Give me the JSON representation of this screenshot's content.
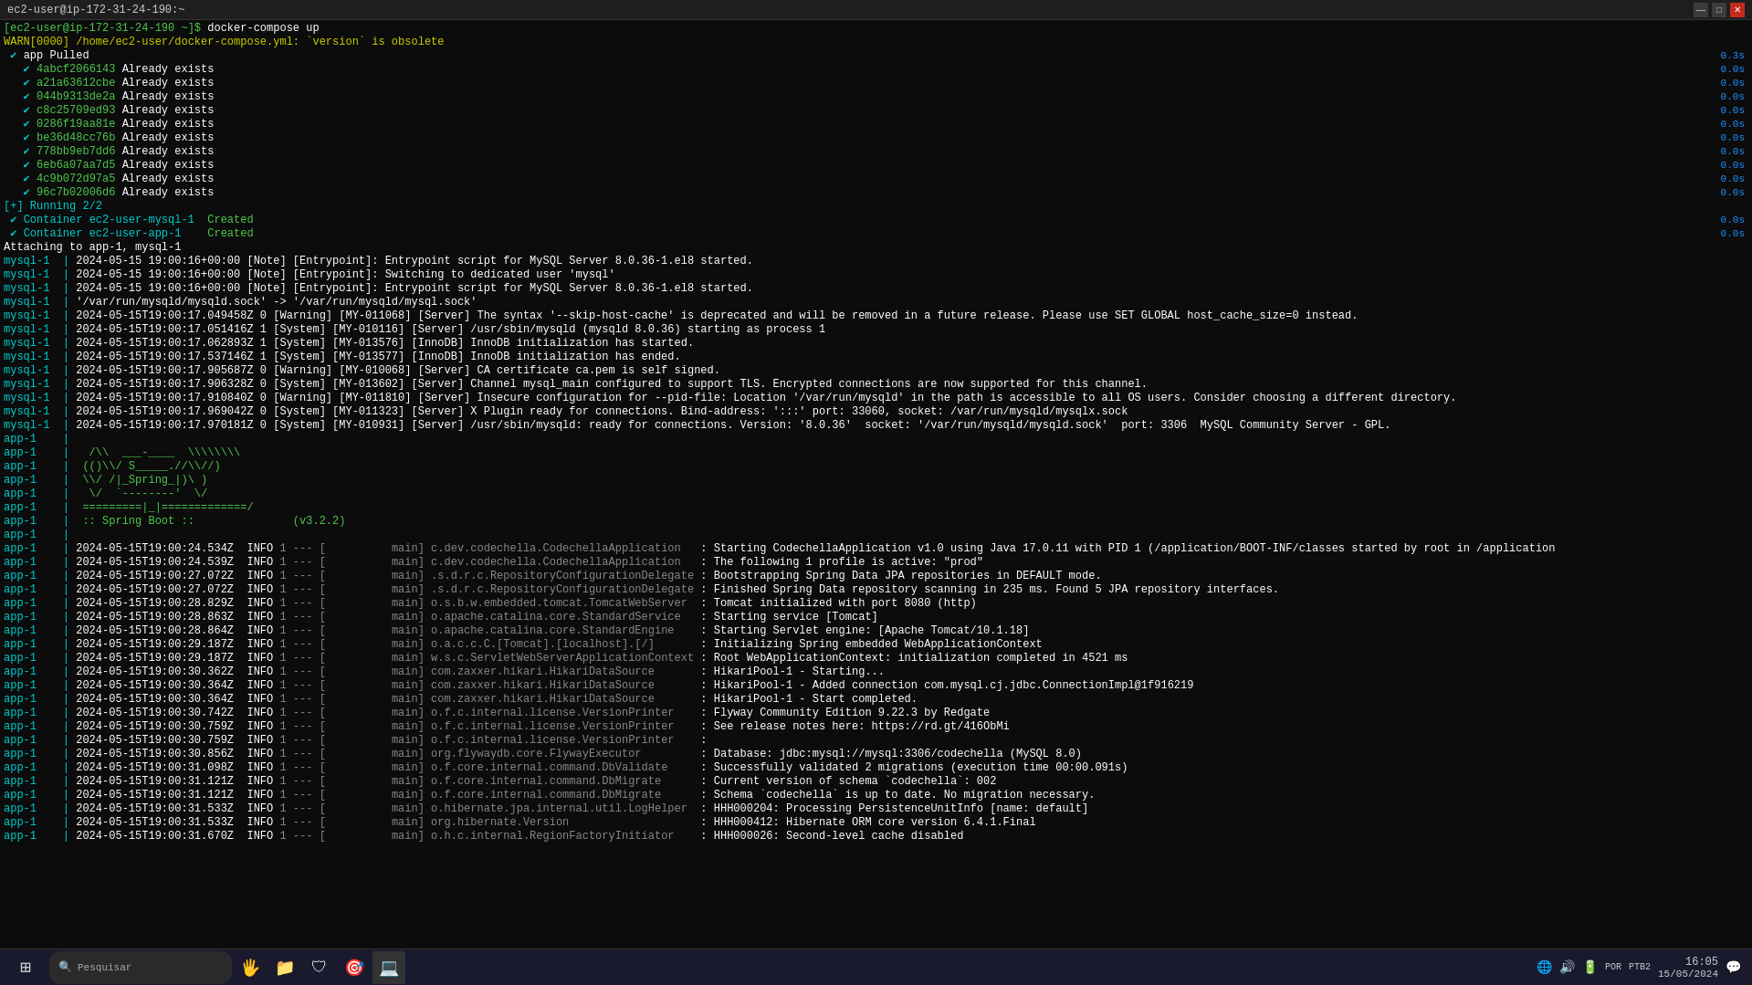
{
  "titlebar": {
    "title": "ec2-user@ip-172-31-24-190:~",
    "minimize": "—",
    "maximize": "□",
    "close": "✕"
  },
  "terminal": {
    "lines": [
      {
        "text": "[ec2-user@ip-172-31-24-190 ~]$ docker-compose up",
        "type": "prompt",
        "right": ""
      },
      {
        "text": "WARN[0000] /home/ec2-user/docker-compose.yml: `version` is obsolete",
        "type": "warn",
        "right": ""
      },
      {
        "text": " ✔ app Pulled",
        "type": "pulled",
        "right": "0.3s"
      },
      {
        "text": "   ✔ 4abcf2066143 Already exists",
        "type": "exists",
        "right": "0.0s"
      },
      {
        "text": "   ✔ a21a63612cbe Already exists",
        "type": "exists",
        "right": "0.0s"
      },
      {
        "text": "   ✔ 044b9313de2a Already exists",
        "type": "exists",
        "right": "0.0s"
      },
      {
        "text": "   ✔ c8c25709ed93 Already exists",
        "type": "exists",
        "right": "0.0s"
      },
      {
        "text": "   ✔ 0286f19aa81e Already exists",
        "type": "exists",
        "right": "0.0s"
      },
      {
        "text": "   ✔ be36d48cc76b Already exists",
        "type": "exists",
        "right": "0.0s"
      },
      {
        "text": "   ✔ 778bb9eb7dd6 Already exists",
        "type": "exists",
        "right": "0.0s"
      },
      {
        "text": "   ✔ 6eb6a07aa7d5 Already exists",
        "type": "exists",
        "right": "0.0s"
      },
      {
        "text": "   ✔ 4c9b072d97a5 Already exists",
        "type": "exists",
        "right": "0.0s"
      },
      {
        "text": "   ✔ 96c7b02006d6 Already exists",
        "type": "exists",
        "right": "0.0s"
      },
      {
        "text": "[+] Running 2/2",
        "type": "running",
        "right": ""
      },
      {
        "text": " ✔ Container ec2-user-mysql-1  Created",
        "type": "created",
        "right": "0.0s"
      },
      {
        "text": " ✔ Container ec2-user-app-1    Created",
        "type": "created",
        "right": "0.0s"
      },
      {
        "text": "Attaching to app-1, mysql-1",
        "type": "normal",
        "right": ""
      },
      {
        "text": "mysql-1  | 2024-05-15 19:00:16+00:00 [Note] [Entrypoint]: Entrypoint script for MySQL Server 8.0.36-1.el8 started.",
        "type": "mysql",
        "right": ""
      },
      {
        "text": "mysql-1  | 2024-05-15 19:00:16+00:00 [Note] [Entrypoint]: Switching to dedicated user 'mysql'",
        "type": "mysql",
        "right": ""
      },
      {
        "text": "mysql-1  | 2024-05-15 19:00:16+00:00 [Note] [Entrypoint]: Entrypoint script for MySQL Server 8.0.36-1.el8 started.",
        "type": "mysql",
        "right": ""
      },
      {
        "text": "mysql-1  | '/var/run/mysqld/mysqld.sock' -> '/var/run/mysqld/mysql.sock'",
        "type": "mysql",
        "right": ""
      },
      {
        "text": "mysql-1  | 2024-05-15T19:00:17.049458Z 0 [Warning] [MY-011068] [Server] The syntax '--skip-host-cache' is deprecated and will be removed in a future release. Please use SET GLOBAL host_cache_size=0 instead.",
        "type": "mysql",
        "right": ""
      },
      {
        "text": "mysql-1  | 2024-05-15T19:00:17.051416Z 1 [System] [MY-010116] [Server] /usr/sbin/mysqld (mysqld 8.0.36) starting as process 1",
        "type": "mysql",
        "right": ""
      },
      {
        "text": "mysql-1  | 2024-05-15T19:00:17.062893Z 1 [System] [MY-013576] [InnoDB] InnoDB initialization has started.",
        "type": "mysql",
        "right": ""
      },
      {
        "text": "mysql-1  | 2024-05-15T19:00:17.537146Z 1 [System] [MY-013577] [InnoDB] InnoDB initialization has ended.",
        "type": "mysql",
        "right": ""
      },
      {
        "text": "mysql-1  | 2024-05-15T19:00:17.905687Z 0 [Warning] [MY-010068] [Server] CA certificate ca.pem is self signed.",
        "type": "mysql",
        "right": ""
      },
      {
        "text": "mysql-1  | 2024-05-15T19:00:17.906328Z 0 [System] [MY-013602] [Server] Channel mysql_main configured to support TLS. Encrypted connections are now supported for this channel.",
        "type": "mysql",
        "right": ""
      },
      {
        "text": "mysql-1  | 2024-05-15T19:00:17.910840Z 0 [Warning] [MY-011810] [Server] Insecure configuration for --pid-file: Location '/var/run/mysqld' in the path is accessible to all OS users. Consider choosing a different directory.",
        "type": "mysql",
        "right": ""
      },
      {
        "text": "mysql-1  | 2024-05-15T19:00:17.969042Z 0 [System] [MY-011323] [Server] X Plugin ready for connections. Bind-address: ':::' port: 33060, socket: /var/run/mysqld/mysqlx.sock",
        "type": "mysql",
        "right": ""
      },
      {
        "text": "mysql-1  | 2024-05-15T19:00:17.970181Z 0 [System] [MY-010931] [Server] /usr/sbin/mysqld: ready for connections. Version: '8.0.36'  socket: '/var/run/mysqld/mysqld.sock'  port: 3306  MySQL Community Server - GPL.",
        "type": "mysql",
        "right": ""
      },
      {
        "text": "app-1    |",
        "type": "app",
        "right": ""
      },
      {
        "text": "app-1    |   /\\\\  ___-____  \\\\\\\\\\\\\\\\",
        "type": "spring",
        "right": ""
      },
      {
        "text": "app-1    |  (()\\\\/ S_____.//\\\\//)",
        "type": "spring",
        "right": ""
      },
      {
        "text": "app-1    |  \\\\/ /|_Spring_|)\\ )",
        "type": "spring",
        "right": ""
      },
      {
        "text": "app-1    |   \\/  `--------'  \\/",
        "type": "spring",
        "right": ""
      },
      {
        "text": "app-1    |  =========|_|=============/",
        "type": "spring",
        "right": ""
      },
      {
        "text": "app-1    |  :: Spring Boot ::               (v3.2.2)",
        "type": "spring",
        "right": ""
      },
      {
        "text": "app-1    |",
        "type": "app",
        "right": ""
      },
      {
        "text": "app-1    | 2024-05-15T19:00:24.534Z  INFO 1 --- [          main] c.dev.codechella.CodechellaApplication   : Starting CodechellaApplication v1.0 using Java 17.0.11 with PID 1 (/application/BOOT-INF/classes started by root in /application",
        "type": "app",
        "right": ""
      },
      {
        "text": "app-1    | 2024-05-15T19:00:24.539Z  INFO 1 --- [          main] c.dev.codechella.CodechellaApplication   : The following 1 profile is active: \"prod\"",
        "type": "app",
        "right": ""
      },
      {
        "text": "app-1    | 2024-05-15T19:00:27.072Z  INFO 1 --- [          main] .s.d.r.c.RepositoryConfigurationDelegate : Bootstrapping Spring Data JPA repositories in DEFAULT mode.",
        "type": "app",
        "right": ""
      },
      {
        "text": "app-1    | 2024-05-15T19:00:27.072Z  INFO 1 --- [          main] .s.d.r.c.RepositoryConfigurationDelegate : Finished Spring Data repository scanning in 235 ms. Found 5 JPA repository interfaces.",
        "type": "app",
        "right": ""
      },
      {
        "text": "app-1    | 2024-05-15T19:00:28.829Z  INFO 1 --- [          main] o.s.b.w.embedded.tomcat.TomcatWebServer  : Tomcat initialized with port 8080 (http)",
        "type": "app",
        "right": ""
      },
      {
        "text": "app-1    | 2024-05-15T19:00:28.863Z  INFO 1 --- [          main] o.apache.catalina.core.StandardService   : Starting service [Tomcat]",
        "type": "app",
        "right": ""
      },
      {
        "text": "app-1    | 2024-05-15T19:00:28.864Z  INFO 1 --- [          main] o.apache.catalina.core.StandardEngine    : Starting Servlet engine: [Apache Tomcat/10.1.18]",
        "type": "app",
        "right": ""
      },
      {
        "text": "app-1    | 2024-05-15T19:00:29.187Z  INFO 1 --- [          main] o.a.c.c.C.[Tomcat].[localhost].[/]       : Initializing Spring embedded WebApplicationContext",
        "type": "app",
        "right": ""
      },
      {
        "text": "app-1    | 2024-05-15T19:00:29.187Z  INFO 1 --- [          main] w.s.c.ServletWebServerApplicationContext : Root WebApplicationContext: initialization completed in 4521 ms",
        "type": "app",
        "right": ""
      },
      {
        "text": "app-1    | 2024-05-15T19:00:30.362Z  INFO 1 --- [          main] com.zaxxer.hikari.HikariDataSource       : HikariPool-1 - Starting...",
        "type": "app",
        "right": ""
      },
      {
        "text": "app-1    | 2024-05-15T19:00:30.364Z  INFO 1 --- [          main] com.zaxxer.hikari.HikariDataSource       : HikariPool-1 - Added connection com.mysql.cj.jdbc.ConnectionImpl@1f916219",
        "type": "app",
        "right": ""
      },
      {
        "text": "app-1    | 2024-05-15T19:00:30.364Z  INFO 1 --- [          main] com.zaxxer.hikari.HikariDataSource       : HikariPool-1 - Start completed.",
        "type": "app",
        "right": ""
      },
      {
        "text": "app-1    | 2024-05-15T19:00:30.742Z  INFO 1 --- [          main] o.f.c.internal.license.VersionPrinter    : Flyway Community Edition 9.22.3 by Redgate",
        "type": "app",
        "right": ""
      },
      {
        "text": "app-1    | 2024-05-15T19:00:30.759Z  INFO 1 --- [          main] o.f.c.internal.license.VersionPrinter    : See release notes here: https://rd.gt/416ObMi",
        "type": "app",
        "right": ""
      },
      {
        "text": "app-1    | 2024-05-15T19:00:30.759Z  INFO 1 --- [          main] o.f.c.internal.license.VersionPrinter    :",
        "type": "app",
        "right": ""
      },
      {
        "text": "app-1    | 2024-05-15T19:00:30.856Z  INFO 1 --- [          main] org.flywaydb.core.FlywayExecutor         : Database: jdbc:mysql://mysql:3306/codechella (MySQL 8.0)",
        "type": "app",
        "right": ""
      },
      {
        "text": "app-1    | 2024-05-15T19:00:31.098Z  INFO 1 --- [          main] o.f.core.internal.command.DbValidate     : Successfully validated 2 migrations (execution time 00:00.091s)",
        "type": "app",
        "right": ""
      },
      {
        "text": "app-1    | 2024-05-15T19:00:31.121Z  INFO 1 --- [          main] o.f.core.internal.command.DbMigrate      : Current version of schema `codechella`: 002",
        "type": "app",
        "right": ""
      },
      {
        "text": "app-1    | 2024-05-15T19:00:31.121Z  INFO 1 --- [          main] o.f.core.internal.command.DbMigrate      : Schema `codechella` is up to date. No migration necessary.",
        "type": "app",
        "right": ""
      },
      {
        "text": "app-1    | 2024-05-15T19:00:31.533Z  INFO 1 --- [          main] o.hibernate.jpa.internal.util.LogHelper  : HHH000204: Processing PersistenceUnitInfo [name: default]",
        "type": "app",
        "right": ""
      },
      {
        "text": "app-1    | 2024-05-15T19:00:31.533Z  INFO 1 --- [          main] org.hibernate.Version                    : HHH000412: Hibernate ORM core version 6.4.1.Final",
        "type": "app",
        "right": ""
      },
      {
        "text": "app-1    | 2024-05-15T19:00:31.670Z  INFO 1 --- [          main] o.h.c.internal.RegionFactoryInitiator    : HHH000026: Second-level cache disabled",
        "type": "app",
        "right": ""
      }
    ]
  },
  "taskbar": {
    "start_icon": "⊞",
    "search_placeholder": "Pesquisar",
    "time": "16:05",
    "date": "15/05/2024",
    "lang": "POR",
    "layout": "PTB2",
    "icons": [
      "🖐",
      "📁",
      "🛡",
      "🎯",
      "💻"
    ]
  }
}
